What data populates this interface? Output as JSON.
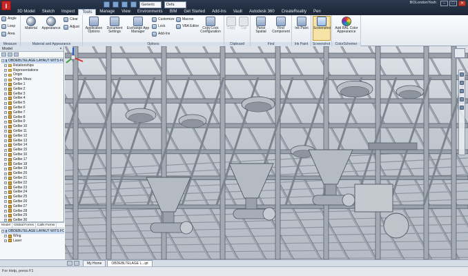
{
  "app": {
    "logo": "I",
    "user": "BOLondonYosh"
  },
  "quick_access": {
    "material_combo": "Generic",
    "appearance_combo": "Defa"
  },
  "ribbon_tabs": [
    "3D Model",
    "Sketch",
    "Inspect",
    "Tools",
    "Manage",
    "View",
    "Environments",
    "BIM",
    "Get Started",
    "Add-Ins",
    "Vault",
    "Autodesk 360",
    "CreateReality",
    "Pen"
  ],
  "active_tab": "Tools",
  "window_controls": {
    "minimize": "–",
    "maximize": "□",
    "close": "✕"
  },
  "ribbon": {
    "panels": [
      {
        "title": "Measure",
        "buttons": [
          "Angle",
          "Loop",
          "Area"
        ]
      },
      {
        "title": "Material and Appearance",
        "buttons": [
          "Material",
          "Appearance",
          "Clear",
          "Adjust"
        ]
      },
      {
        "title": "Options",
        "buttons": [
          "Application Options",
          "Document Settings",
          "Exchange App Manager",
          "Customize",
          "Macros",
          "VBA Editor",
          "Add-Ins",
          "Lock",
          "Copy Lock Configuration"
        ]
      },
      {
        "title": "Clipboard",
        "buttons": [
          "Copy",
          "Cut"
        ]
      },
      {
        "title": "Find",
        "buttons": [
          "Parse Spatial",
          "Find Component"
        ]
      },
      {
        "title": "Ink Paint",
        "buttons": [
          "Ink Paint"
        ]
      },
      {
        "title": "Screenshot",
        "buttons": [
          "Screenshot"
        ]
      },
      {
        "title": "ColorSchemer",
        "buttons": [
          "Add RAL Color Appearance"
        ]
      }
    ]
  },
  "browser": {
    "title": "Model",
    "tree": [
      {
        "label": "OBDEBLTELAGE LAYAUT WITS FOR",
        "kind": "root"
      },
      {
        "label": "Relationships",
        "kind": "folder"
      },
      {
        "label": "Representations",
        "kind": "folder"
      },
      {
        "label": "Origin",
        "kind": "folder"
      },
      {
        "label": "Origin Mezz",
        "kind": "folder"
      },
      {
        "label": "Gelbe:1",
        "kind": "part"
      },
      {
        "label": "Gelbe:2",
        "kind": "part"
      },
      {
        "label": "Gelbe:3",
        "kind": "part"
      },
      {
        "label": "Gelbe:4",
        "kind": "part"
      },
      {
        "label": "Gelbe:5",
        "kind": "part"
      },
      {
        "label": "Gelbe:6",
        "kind": "part"
      },
      {
        "label": "Gelbe:7",
        "kind": "part"
      },
      {
        "label": "Gelbe:8",
        "kind": "part"
      },
      {
        "label": "Gelbe:9",
        "kind": "part"
      },
      {
        "label": "Gelbe:10",
        "kind": "part"
      },
      {
        "label": "Gelbe:11",
        "kind": "part"
      },
      {
        "label": "Gelbe:12",
        "kind": "part"
      },
      {
        "label": "Gelbe:13",
        "kind": "part"
      },
      {
        "label": "Gelbe:14",
        "kind": "part"
      },
      {
        "label": "Gelbe:15",
        "kind": "part"
      },
      {
        "label": "Gelbe:16",
        "kind": "part"
      },
      {
        "label": "Gelbe:17",
        "kind": "part"
      },
      {
        "label": "Gelbe:18",
        "kind": "part"
      },
      {
        "label": "Gelbe:19",
        "kind": "part"
      },
      {
        "label": "Gelbe:20",
        "kind": "part"
      },
      {
        "label": "Gelbe:21",
        "kind": "part"
      },
      {
        "label": "Gelbe:22",
        "kind": "part"
      },
      {
        "label": "Gelbe:23",
        "kind": "part"
      },
      {
        "label": "Gelbe:24",
        "kind": "part"
      },
      {
        "label": "Gelbe:25",
        "kind": "part"
      },
      {
        "label": "Gelbe:26",
        "kind": "part"
      },
      {
        "label": "Gelbe:27",
        "kind": "part"
      },
      {
        "label": "Gelbe:28",
        "kind": "part"
      },
      {
        "label": "Gelbe:29",
        "kind": "part"
      },
      {
        "label": "Gelbe:30",
        "kind": "part"
      }
    ],
    "lower_tabs": [
      "Model",
      "Global Forms",
      "Calls Forms"
    ],
    "lower_tree": [
      {
        "label": "OBDEBLTELAGE LAYAUT WITS FOR",
        "kind": "root"
      },
      {
        "label": "Wing",
        "kind": "part"
      },
      {
        "label": "Laser",
        "kind": "part"
      }
    ]
  },
  "document_tabs": [
    "My Home",
    "OBDEBLTELAGE L...ipt"
  ],
  "active_document": "OBDEBLTELAGE L...ipt",
  "status": {
    "message": "For Help, press F1"
  },
  "colors": {
    "accent": "#2b3a50",
    "steel": "#9aa1ab",
    "steel_dark": "#4e5661",
    "app_red": "#c62828"
  }
}
